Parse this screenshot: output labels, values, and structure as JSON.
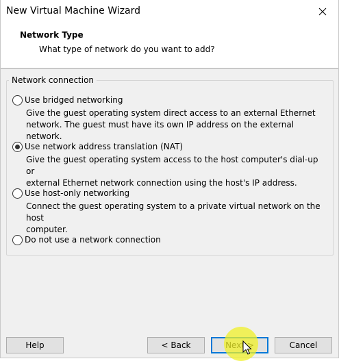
{
  "window": {
    "title": "New Virtual Machine Wizard"
  },
  "header": {
    "title": "Network Type",
    "subtitle": "What type of network do you want to add?"
  },
  "group": {
    "label": "Network connection"
  },
  "options": [
    {
      "label": "Use bridged networking",
      "desc_line1": "Give the guest operating system direct access to an external Ethernet",
      "desc_line2": "network. The guest must have its own IP address on the external network.",
      "checked": false
    },
    {
      "label": "Use network address translation (NAT)",
      "desc_line1": "Give the guest operating system access to the host computer's dial-up or",
      "desc_line2": "external Ethernet network connection using the host's IP address.",
      "checked": true
    },
    {
      "label": "Use host-only networking",
      "desc_line1": "Connect the guest operating system to a private virtual network on the host",
      "desc_line2": "computer.",
      "checked": false
    },
    {
      "label": "Do not use a network connection",
      "checked": false
    }
  ],
  "buttons": {
    "help": "Help",
    "back": "< Back",
    "next": "Next >",
    "cancel": "Cancel"
  },
  "icons": {
    "close": "close-icon",
    "cursor": "mouse-cursor-icon"
  },
  "colors": {
    "accent": "#0078d7",
    "highlight": "#f0f028"
  }
}
